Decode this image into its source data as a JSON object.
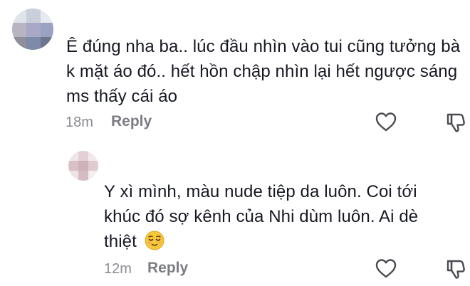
{
  "comments": [
    {
      "text": "Ê đúng nha ba.. lúc đầu nhìn vào tui cũng tưởng bà k mặt áo đó.. hết hồn chập nhìn lại hết ngược sáng ms thấy cái áo",
      "time": "18m",
      "reply_label": "Reply",
      "avatar_icon": "pixelated-avatar",
      "like_icon": "heart-outline-icon",
      "dislike_icon": "thumbs-down-outline-icon"
    },
    {
      "text": "Y xì mình, màu nude tiệp da luôn. Coi tới khúc đó sợ kênh của Nhi dùm luôn. Ai dè thiệt",
      "emoji": "relieved-face-emoji",
      "time": "12m",
      "reply_label": "Reply",
      "avatar_icon": "pixelated-avatar",
      "like_icon": "heart-outline-icon",
      "dislike_icon": "thumbs-down-outline-icon"
    }
  ],
  "colors": {
    "text": "#161823",
    "meta": "#8a8b91",
    "icon": "#4a4b52"
  }
}
